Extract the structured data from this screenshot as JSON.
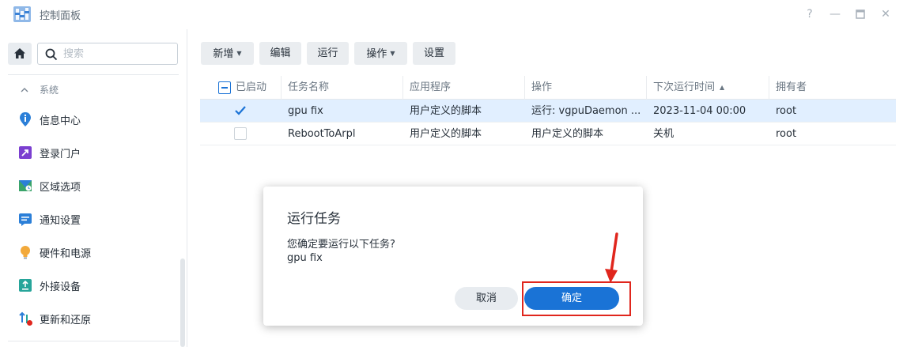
{
  "window": {
    "title": "控制面板",
    "controls": {
      "help": "?",
      "minimize": "—",
      "maximize": "□",
      "close": "✕"
    }
  },
  "sidebar": {
    "search_placeholder": "搜索",
    "group_label": "系统",
    "items": [
      {
        "label": "信息中心",
        "icon": "info-icon"
      },
      {
        "label": "登录门户",
        "icon": "login-portal-icon"
      },
      {
        "label": "区域选项",
        "icon": "region-icon"
      },
      {
        "label": "通知设置",
        "icon": "notification-icon"
      },
      {
        "label": "硬件和电源",
        "icon": "bulb-icon"
      },
      {
        "label": "外接设备",
        "icon": "external-device-icon"
      },
      {
        "label": "更新和还原",
        "icon": "update-icon"
      }
    ]
  },
  "toolbar": {
    "create": "新增",
    "edit": "编辑",
    "run": "运行",
    "action": "操作",
    "settings": "设置"
  },
  "grid": {
    "columns": [
      "已启动",
      "任务名称",
      "应用程序",
      "操作",
      "下次运行时间",
      "拥有者"
    ],
    "sort_indicator": "▲",
    "rows": [
      {
        "enabled": true,
        "name": "gpu fix",
        "app": "用户定义的脚本",
        "action": "运行: vgpuDaemon ...",
        "next_run": "2023-11-04 00:00",
        "owner": "root"
      },
      {
        "enabled": false,
        "name": "RebootToArpl",
        "app": "用户定义的脚本",
        "action": "用户定义的脚本",
        "next_run": "关机",
        "owner": "root"
      }
    ]
  },
  "dialog": {
    "title": "运行任务",
    "message": "您确定要运行以下任务?",
    "task": "gpu fix",
    "cancel": "取消",
    "ok": "确定"
  },
  "colors": {
    "accent": "#1a73d6",
    "selected_row": "#e1efff",
    "annotation": "#e0261d"
  }
}
